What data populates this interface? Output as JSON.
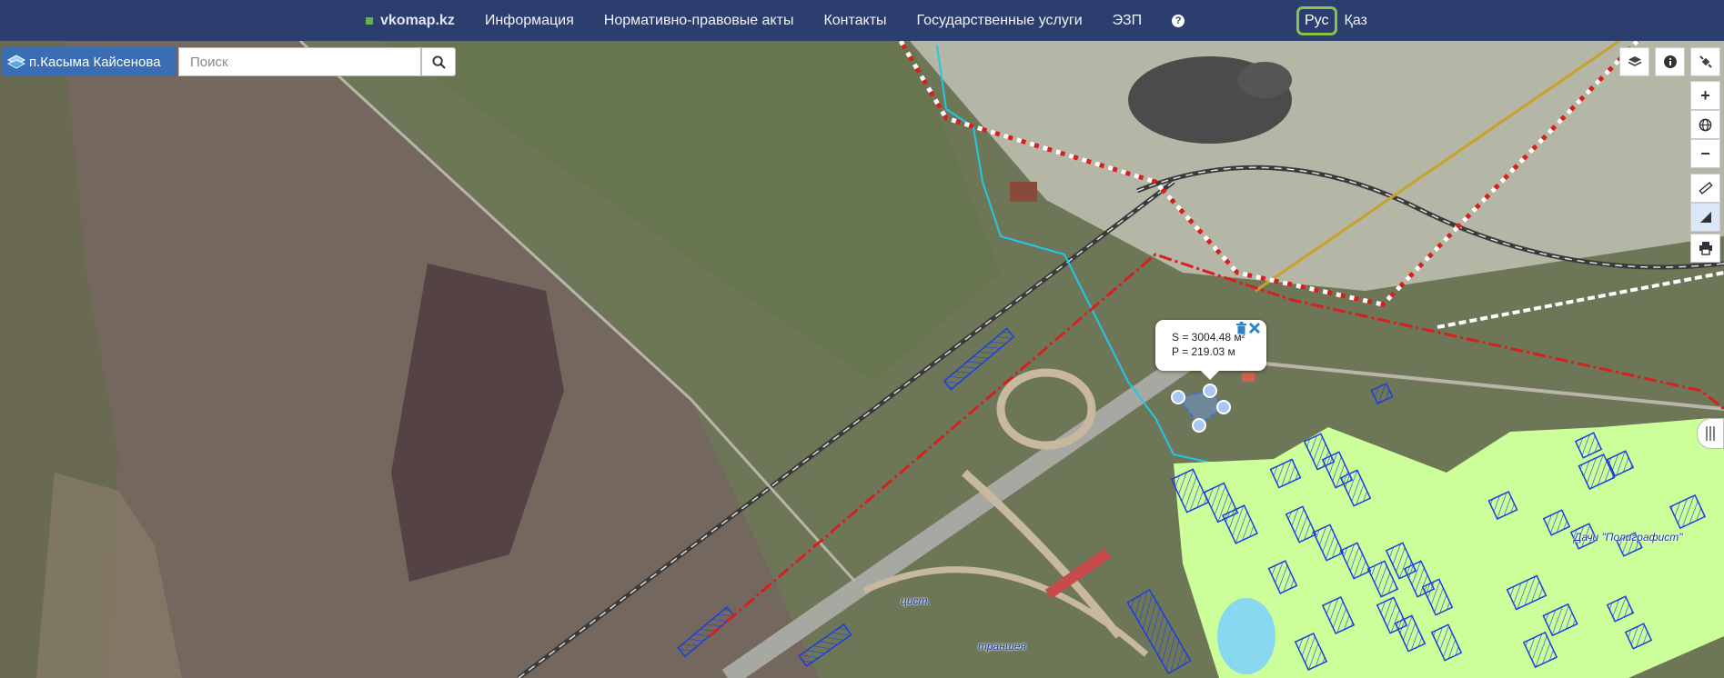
{
  "nav": {
    "brand": "vkomap.kz",
    "items": [
      "Информация",
      "Нормативно-правовые акты",
      "Контакты",
      "Государственные услуги",
      "ЭЗП"
    ],
    "help": "?"
  },
  "lang": {
    "active": "Рус",
    "other": "Қаз"
  },
  "location": {
    "label": "п.Касыма Кайсенова"
  },
  "search": {
    "placeholder": "Поиск"
  },
  "popup": {
    "area": "S = 3004.48 м²",
    "perimeter": "P = 219.03 м"
  },
  "map_labels": {
    "dachi": "Дачи \"Полиграфист\"",
    "cist": "цист.",
    "transhea": "траншея"
  },
  "icons": {
    "layers": "layers-icon",
    "info": "info-icon",
    "tools": "satellite-icon",
    "zoom_in": "plus-icon",
    "globe": "globe-icon",
    "zoom_out": "minus-icon",
    "ruler": "ruler-icon",
    "area": "area-measure-icon",
    "print": "print-icon",
    "search": "search-icon",
    "trash": "trash-icon",
    "close": "close-icon"
  },
  "colors": {
    "topbar": "#2b3e6e",
    "accent": "#8bc34a",
    "parcel_fill": "#ccff99",
    "parcel_stroke": "#1a3fe0",
    "boundary_red": "#d62020"
  }
}
